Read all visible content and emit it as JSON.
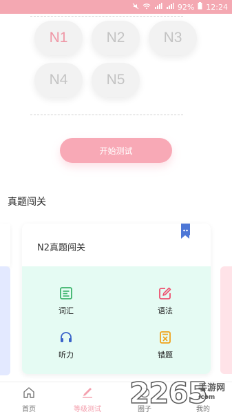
{
  "status_bar": {
    "icons": [
      "mute-icon",
      "wifi-icon",
      "signal-4g-icon",
      "signal-icon",
      "battery-icon"
    ],
    "battery": "92%",
    "time": "12:24"
  },
  "levels": {
    "items": [
      "N1",
      "N2",
      "N3",
      "N4",
      "N5"
    ],
    "selected": "N1",
    "active_color": "#ef97a6"
  },
  "start_button": "开始测试",
  "section_title": "真题闯关",
  "card": {
    "title": "N2真题闯关",
    "items": [
      {
        "label": "词汇",
        "icon": "vocabulary-icon",
        "color": "#3bb36a"
      },
      {
        "label": "语法",
        "icon": "grammar-edit-icon",
        "color": "#ee4f6e"
      },
      {
        "label": "听力",
        "icon": "headphones-icon",
        "color": "#3a63c9"
      },
      {
        "label": "错题",
        "icon": "mistakes-icon",
        "color": "#f0a21a"
      }
    ]
  },
  "tabs": [
    {
      "label": "首页",
      "icon": "home-icon"
    },
    {
      "label": "等级测试",
      "icon": "level-test-icon",
      "active": true
    },
    {
      "label": "圈子",
      "icon": "circle-icon"
    },
    {
      "label": "我的",
      "icon": "profile-icon"
    }
  ],
  "watermark": {
    "number": "2265",
    "cn": "手游网",
    "url": ".com"
  },
  "colors": {
    "accent": "#f8a9b6",
    "status_bar": "#f4a8b2",
    "card_body": "#e5fbf3"
  }
}
